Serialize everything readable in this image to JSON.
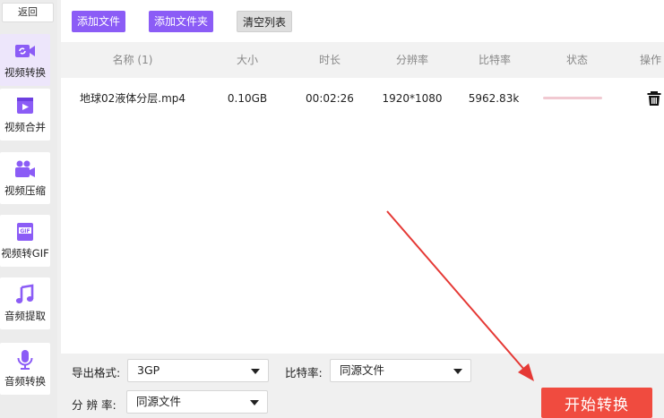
{
  "sidebar": {
    "back_label": "返回",
    "items": [
      {
        "label": "视频转换",
        "icon": "video-convert-icon"
      },
      {
        "label": "视频合并",
        "icon": "video-merge-icon"
      },
      {
        "label": "视频压缩",
        "icon": "video-compress-icon"
      },
      {
        "label": "视频转GIF",
        "icon": "gif-icon"
      },
      {
        "label": "音频提取",
        "icon": "music-note-icon"
      },
      {
        "label": "音频转换",
        "icon": "microphone-icon"
      }
    ],
    "active_index": 0
  },
  "toolbar": {
    "add_file": "添加文件",
    "add_folder": "添加文件夹",
    "clear_list": "清空列表"
  },
  "table": {
    "headers": [
      "名称 (1)",
      "大小",
      "时长",
      "分辨率",
      "比特率",
      "状态",
      "操作"
    ],
    "rows": [
      {
        "name": "地球02液体分层.mp4",
        "size": "0.10GB",
        "duration": "00:02:26",
        "resolution": "1920*1080",
        "bitrate": "5962.83k",
        "progress": 0
      }
    ]
  },
  "settings": {
    "format_label": "导出格式:",
    "format_value": "3GP",
    "bitrate_label": "比特率:",
    "bitrate_value": "同源文件",
    "resolution_label": "分 辨 率:",
    "resolution_value": "同源文件"
  },
  "start_button": "开始转换",
  "colors": {
    "accent": "#8b5cf6",
    "start": "#f04b3f",
    "arrow": "#e53935"
  }
}
